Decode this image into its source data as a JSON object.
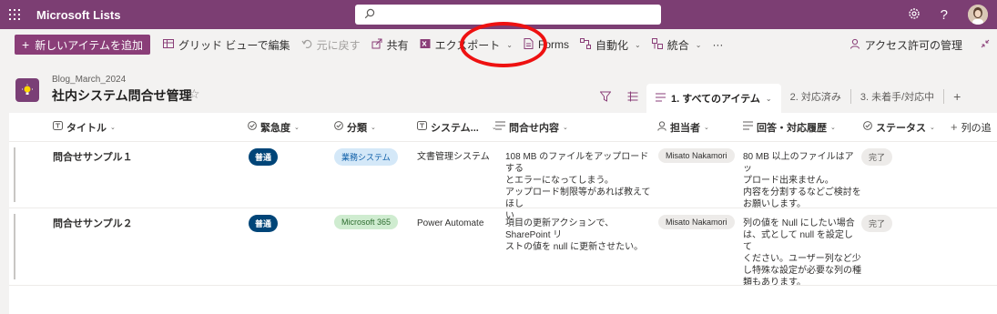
{
  "app": {
    "title": "Microsoft Lists",
    "help": "?"
  },
  "commands": {
    "new_item": "新しいアイテムを追加",
    "grid_edit": "グリッド ビューで編集",
    "undo": "元に戻す",
    "share": "共有",
    "export": "エクスポート",
    "forms": "Forms",
    "automate": "自動化",
    "integrate": "統合",
    "more": "···",
    "access": "アクセス許可の管理"
  },
  "list": {
    "breadcrumb": "Blog_March_2024",
    "title": "社内システム問合せ管理"
  },
  "views": [
    {
      "label": "1. すべてのアイテム"
    },
    {
      "label": "2. 対応済み"
    },
    {
      "label": "3. 未着手/対応中"
    }
  ],
  "columns": {
    "title": "タイトル",
    "urgency": "緊急度",
    "category": "分類",
    "system": "システム...",
    "content": "問合せ内容",
    "assignee": "担当者",
    "answer": "回答・対応履歴",
    "status": "ステータス",
    "add": "列の追"
  },
  "rows": [
    {
      "title": "問合せサンプル１",
      "urgency": "普通",
      "category": "業務システム",
      "system": "文書管理システム",
      "content": [
        "108 MB のファイルをアップロードする",
        "とエラーになってしまう。",
        "アップロード制限等があれば教えてほし",
        "い"
      ],
      "assignee": "Misato Nakamori",
      "answer": [
        "80 MB 以上のファイルはアッ",
        "プロード出来ません。",
        "内容を分割するなどご検討を",
        "お願いします。"
      ],
      "status": "完了"
    },
    {
      "title": "問合せサンプル２",
      "urgency": "普通",
      "category": "Microsoft 365",
      "system": "Power Automate",
      "content": [
        "項目の更新アクションで、SharePoint リ",
        "ストの値を null に更新させたい。"
      ],
      "assignee": "Misato Nakamori",
      "answer": [
        "列の値を Null にしたい場合",
        "は、式として null を設定して",
        "ください。ユーザー列など少",
        "し特殊な設定が必要な列の種",
        "類もあります。"
      ],
      "status": "完了"
    }
  ],
  "colors": {
    "suite_bar": "#7c3e73",
    "primary": "#8a3e78",
    "urgency_pill": "#004578",
    "annotation": "#ee1111"
  }
}
